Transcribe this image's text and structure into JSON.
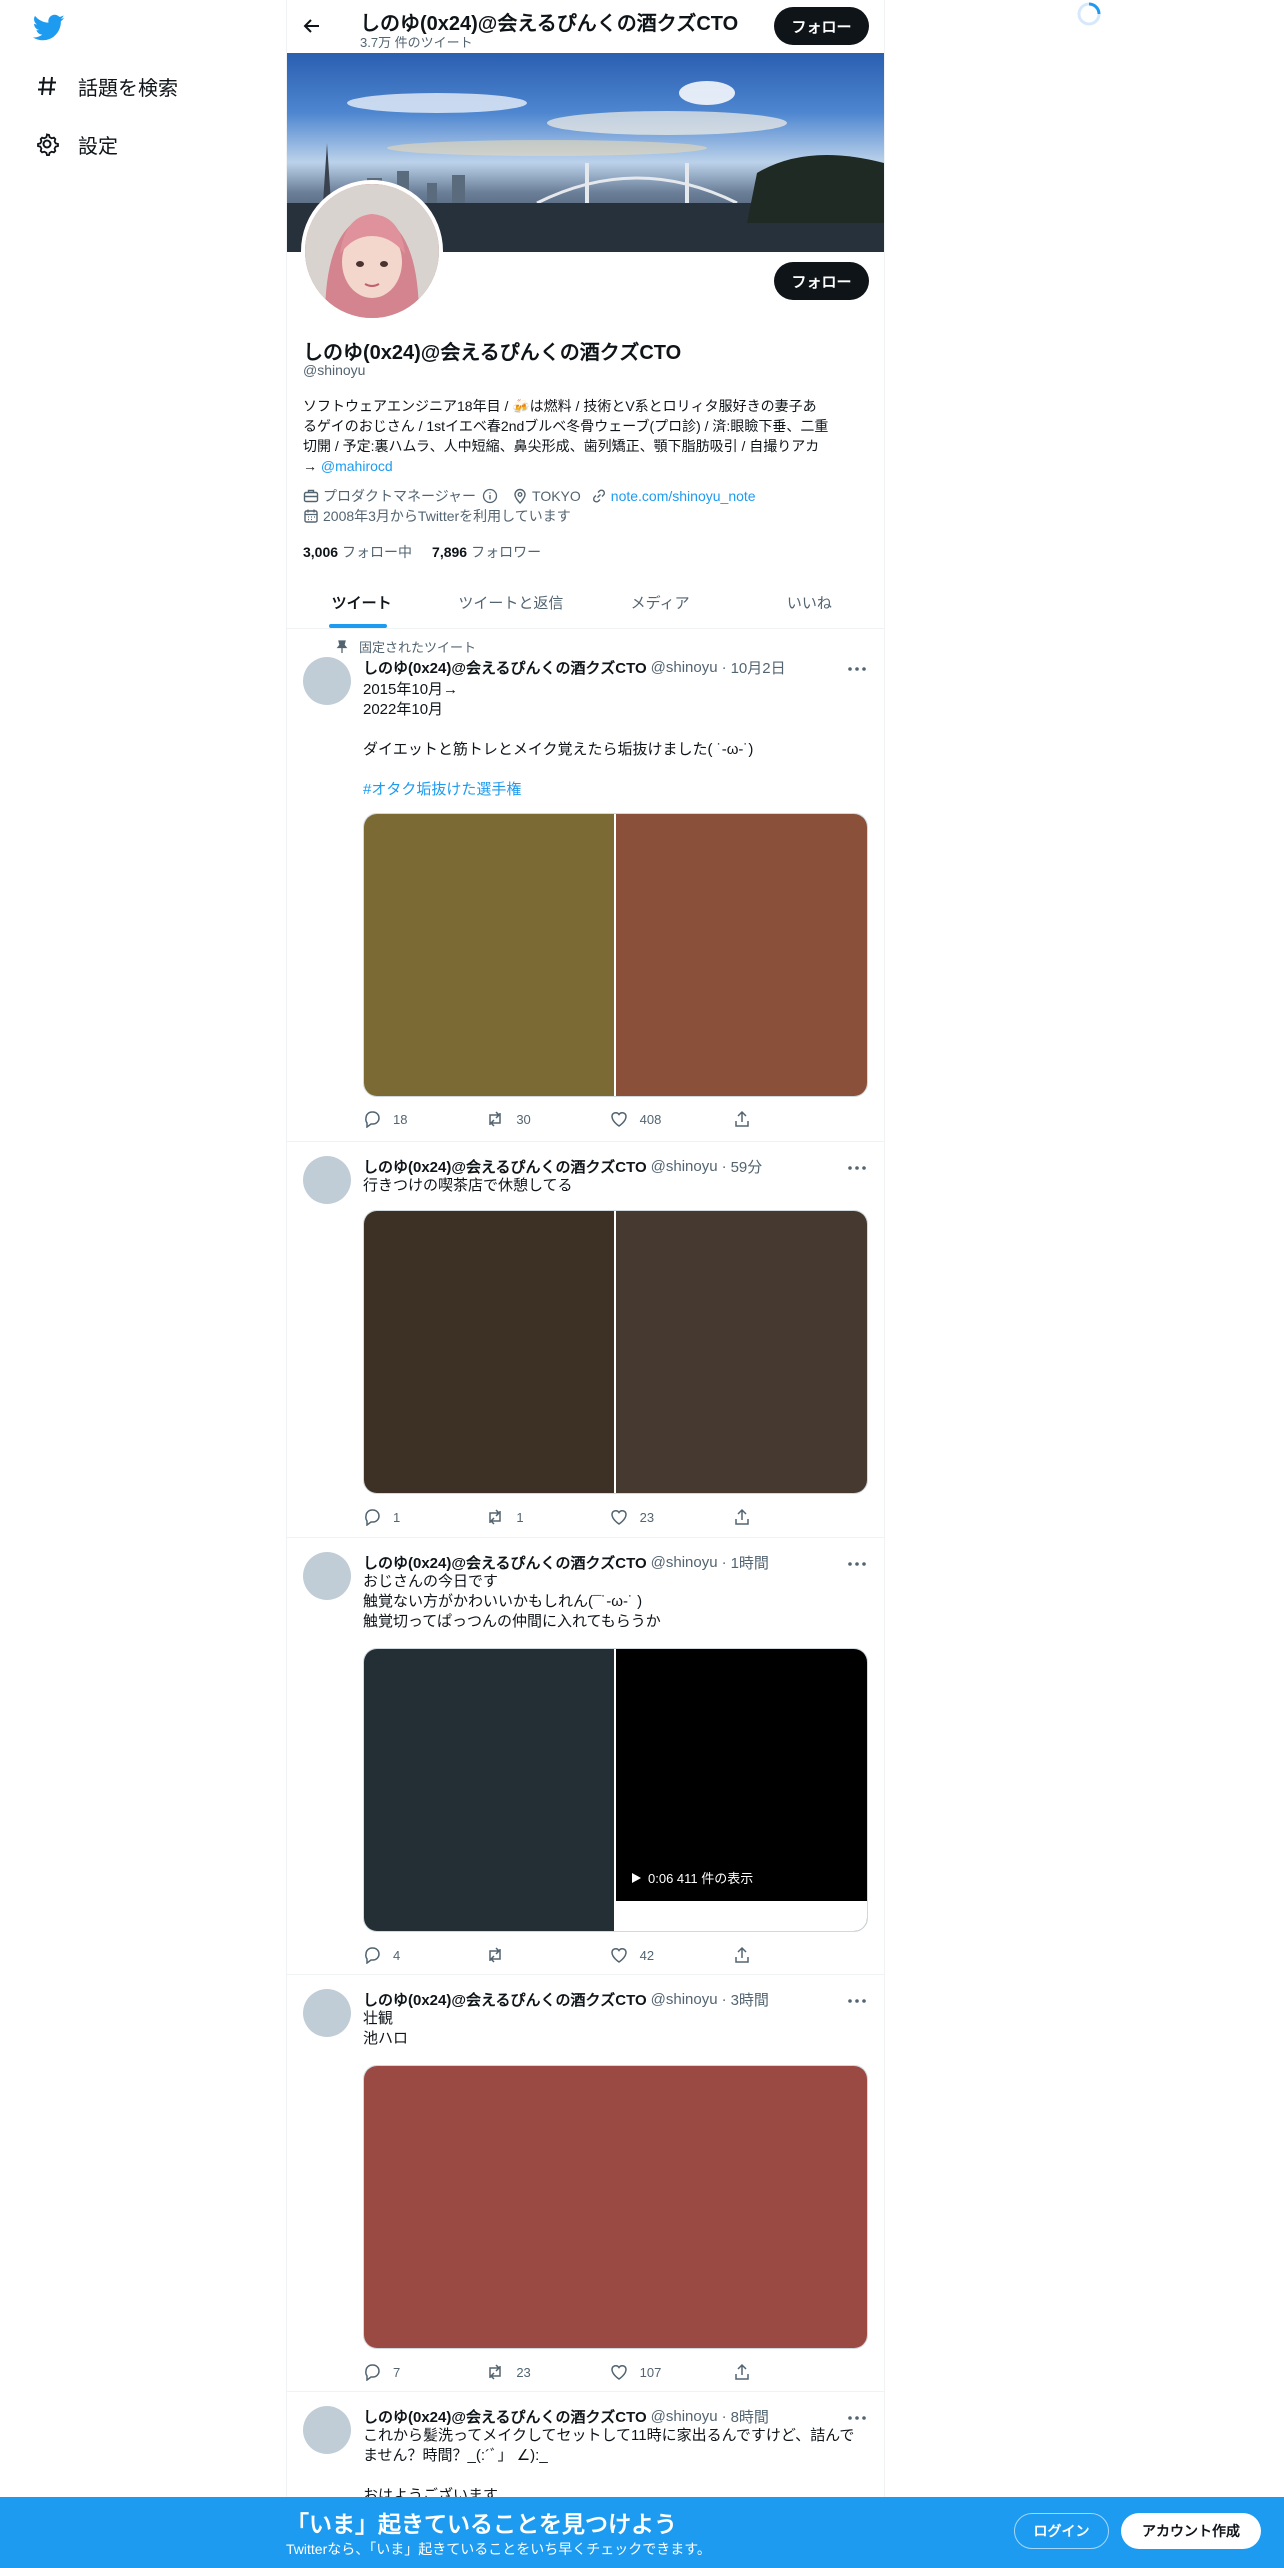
{
  "sidebar": {
    "logo": "twitter-bird-icon",
    "items": [
      {
        "label": "話題を検索",
        "icon": "hashtag-icon"
      },
      {
        "label": "設定",
        "icon": "gear-icon"
      }
    ]
  },
  "topbar": {
    "name": "しのゆ(0x24)@会えるぴんくの酒クズCTO",
    "tweet_count": "3.7万 件のツイート",
    "follow_label": "フォロー"
  },
  "profile": {
    "name": "しのゆ(0x24)@会えるぴんくの酒クズCTO",
    "handle": "@shinoyu",
    "follow_label": "フォロー",
    "bio_lines": [
      "ソフトウェアエンジニア18年目 / 🍻は燃料 / 技術とV系とロリィタ服好きの妻子あ",
      "るゲイのおじさん / 1stイエベ春2ndブルベ冬骨ウェーブ(プロ診) / 済:眼瞼下垂、二重",
      "切開 / 予定:裏ハムラ、人中短縮、鼻尖形成、歯列矯正、顎下脂肪吸引 / 自撮りアカ"
    ],
    "bio_arrow": "→ ",
    "bio_mention": "@mahirocd",
    "job": "プロダクトマネージャー",
    "location": "TOKYO",
    "website": "note.com/shinoyu_note",
    "joined": "2008年3月からTwitterを利用しています",
    "following_count": "3,006",
    "following_label": "フォロー中",
    "followers_count": "7,896",
    "followers_label": "フォロワー"
  },
  "tabs": [
    "ツイート",
    "ツイートと返信",
    "メディア",
    "いいね"
  ],
  "pinned_label": "固定されたツイート",
  "tweets": [
    {
      "name": "しのゆ(0x24)@会えるぴんくの酒クズCTO",
      "handle": "@shinoyu",
      "time": "10月2日",
      "lines": [
        "2015年10月→",
        "2022年10月",
        "",
        "ダイエットと筋トレとメイク覚えたら垢抜けました( ˙-ω-˙)",
        ""
      ],
      "hashtag": "#オタク垢抜けた選手権",
      "media_colors": [
        "#7b6a33",
        "#8a5039"
      ],
      "replies": "18",
      "retweets": "30",
      "likes": "408"
    },
    {
      "name": "しのゆ(0x24)@会えるぴんくの酒クズCTO",
      "handle": "@shinoyu",
      "time": "59分",
      "lines": [
        "行きつけの喫茶店で休憩してる"
      ],
      "media_colors": [
        "#3d3126",
        "#453930"
      ],
      "replies": "1",
      "retweets": "1",
      "likes": "23"
    },
    {
      "name": "しのゆ(0x24)@会えるぴんくの酒クズCTO",
      "handle": "@shinoyu",
      "time": "1時間",
      "lines": [
        "おじさんの今日です",
        "触覚ない方がかわいいかもしれん(¯˙-ω-˙ )",
        "触覚切ってぱっつんの仲間に入れてもらうか"
      ],
      "media_colors": [
        "#232e35",
        "#000000"
      ],
      "video_info": "0:06  411 件の表示",
      "replies": "4",
      "retweets": "",
      "likes": "42"
    },
    {
      "name": "しのゆ(0x24)@会えるぴんくの酒クズCTO",
      "handle": "@shinoyu",
      "time": "3時間",
      "lines": [
        "壮観",
        "池ハロ"
      ],
      "media_colors": [
        "#9b4a43"
      ],
      "replies": "7",
      "retweets": "23",
      "likes": "107"
    },
    {
      "name": "しのゆ(0x24)@会えるぴんくの酒クズCTO",
      "handle": "@shinoyu",
      "time": "8時間",
      "lines": [
        "これから髪洗ってメイクしてセットして11時に家出るんですけど、詰んで",
        "ません？時間？_(:´ﾞ」 ∠):_",
        "",
        "おはようございます"
      ]
    }
  ],
  "bottom_bar": {
    "title": "「いま」起きていることを見つけよう",
    "subtitle": "Twitterなら、「いま」起きていることをいち早くチェックできます。",
    "login_label": "ログイン",
    "signup_label": "アカウント作成"
  },
  "colors": {
    "accent": "#1d9bf0",
    "text": "#0f1419",
    "secondary": "#536471",
    "button": "#0f1419"
  }
}
